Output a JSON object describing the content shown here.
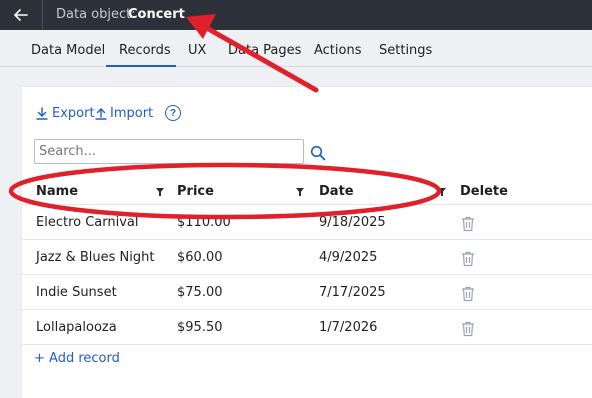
{
  "header": {
    "crumb_label": "Data object:",
    "object_name": "Concert"
  },
  "tabs": [
    {
      "label": "Data Model"
    },
    {
      "label": "Records",
      "active": true
    },
    {
      "label": "UX"
    },
    {
      "label": "Data Pages"
    },
    {
      "label": "Actions"
    },
    {
      "label": "Settings"
    }
  ],
  "toolbar": {
    "export_label": "Export",
    "import_label": "Import",
    "help_glyph": "?"
  },
  "search": {
    "placeholder": "Search...",
    "value": ""
  },
  "table": {
    "columns": [
      {
        "label": "Name",
        "filterable": true
      },
      {
        "label": "Price",
        "filterable": true
      },
      {
        "label": "Date",
        "filterable": true
      },
      {
        "label": "Delete",
        "filterable": false
      }
    ],
    "rows": [
      {
        "name": "Electro Carnival",
        "price": "$110.00",
        "date": "9/18/2025"
      },
      {
        "name": "Jazz & Blues Night",
        "price": "$60.00",
        "date": "4/9/2025"
      },
      {
        "name": "Indie Sunset",
        "price": "$75.00",
        "date": "7/17/2025"
      },
      {
        "name": "Lollapalooza",
        "price": "$95.50",
        "date": "1/7/2026"
      }
    ]
  },
  "add_record_label": "+ Add record",
  "colors": {
    "accent": "#1e5ec8",
    "topbar": "#2d3139",
    "annotation": "#e0202a"
  }
}
